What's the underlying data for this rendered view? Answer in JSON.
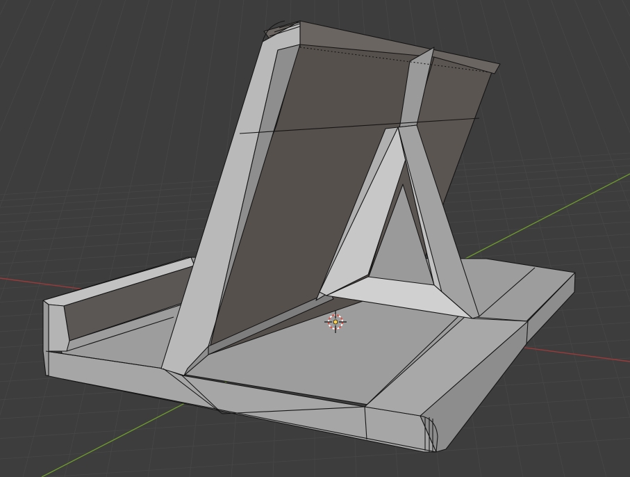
{
  "app": {
    "name": "",
    "viewport_type": "3D Viewport",
    "shading": "solid",
    "overlays": {
      "wireframe": true,
      "grid_floor": true,
      "x_axis_line": true,
      "y_axis_line": true
    }
  },
  "scene": {
    "object": "tablet-stand",
    "parts": [
      "base-plate",
      "angled-back-panel",
      "a-frame-support",
      "front-lip"
    ],
    "origin_marker": "3d-cursor-icon"
  },
  "colors": {
    "background": "#3d3d3d",
    "grid_line": "#474747",
    "x_axis": "#9b3a3a",
    "y_axis": "#6d9a2c",
    "panel_light": "#b6b6b6",
    "panel_mid": "#8f8f8f",
    "panel_dark": "#5f5b58",
    "panel_face": "#524c48",
    "edge": "#111111",
    "cursor_red": "#e84a3a",
    "cursor_center": "#ffd24a"
  }
}
